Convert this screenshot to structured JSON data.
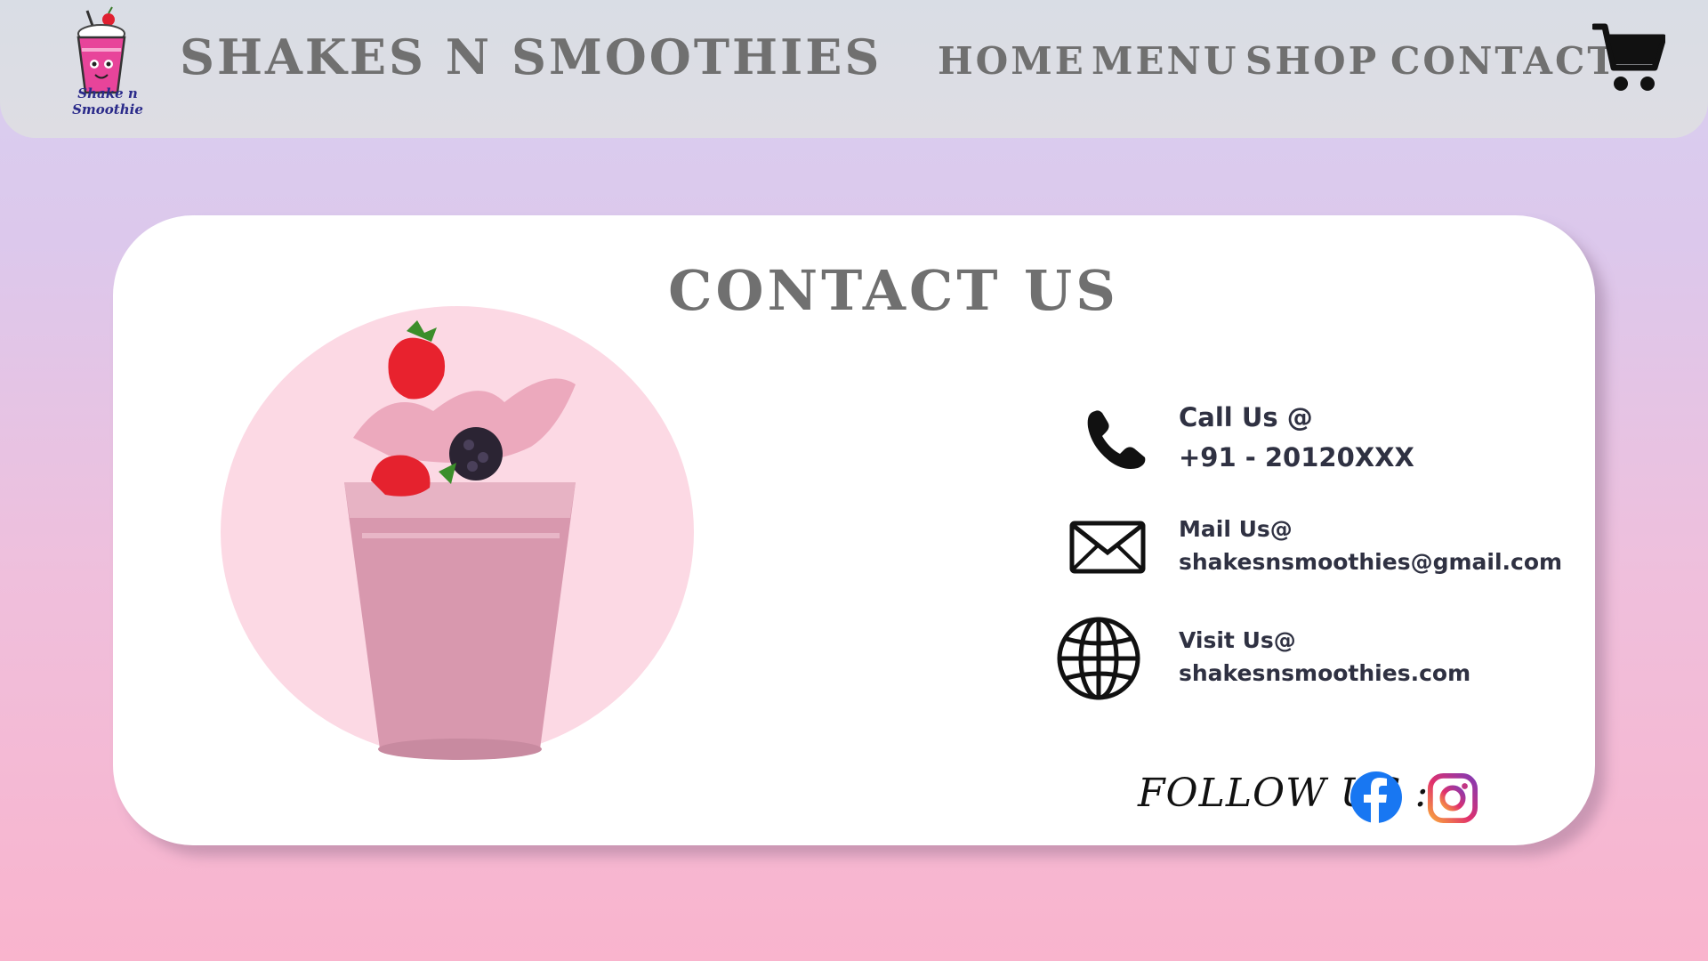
{
  "header": {
    "logo_text": "Shake n Smoothie",
    "brand": "SHAKES N SMOOTHIES",
    "nav": [
      "HOME",
      "MENU",
      "SHOP",
      "CONTACT"
    ],
    "cart_icon": "shopping-cart-icon"
  },
  "contact": {
    "title": "CONTACT US",
    "items": [
      {
        "icon": "phone-icon",
        "label": "Call Us @",
        "value": "+91 - 20120XXX"
      },
      {
        "icon": "mail-icon",
        "label": "Mail Us@",
        "value": "shakesnsmoothies@gmail.com"
      },
      {
        "icon": "globe-icon",
        "label": "Visit Us@",
        "value": "shakesnsmoothies.com"
      }
    ],
    "follow_label": "FOLLOW US :",
    "social": [
      "facebook-icon",
      "instagram-icon"
    ]
  },
  "colors": {
    "heading_gray": "#707070",
    "text_dark": "#2f3142",
    "facebook_blue": "#1877f2",
    "hero_circle": "#fcd9e4"
  }
}
